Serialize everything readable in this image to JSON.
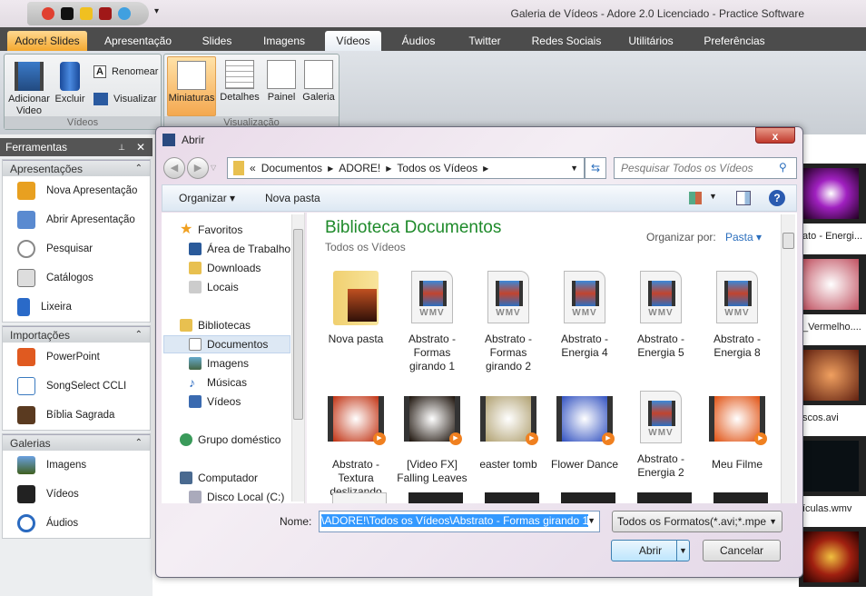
{
  "window": {
    "title": "Galeria de Vídeos - Adore 2.0 Licenciado - Practice Software"
  },
  "qat": {
    "icons": [
      "help-icon",
      "screen-icon",
      "notes-icon",
      "bible-icon",
      "chat-icon"
    ],
    "more": "▾"
  },
  "tabs": [
    {
      "label": "Adore! Slides"
    },
    {
      "label": "Apresentação"
    },
    {
      "label": "Slides"
    },
    {
      "label": "Imagens"
    },
    {
      "label": "Vídeos",
      "selected": true
    },
    {
      "label": "Áudios"
    },
    {
      "label": "Twitter"
    },
    {
      "label": "Redes Sociais"
    },
    {
      "label": "Utilitários"
    },
    {
      "label": "Preferências"
    }
  ],
  "ribbon": {
    "videos_group": {
      "label": "Vídeos",
      "add": "Adicionar Video",
      "delete": "Excluir",
      "rename": "Renomear",
      "preview": "Visualizar"
    },
    "view_group": {
      "label": "Visualização",
      "items": [
        {
          "label": "Miniaturas",
          "selected": true
        },
        {
          "label": "Detalhes"
        },
        {
          "label": "Painel"
        },
        {
          "label": "Galeria"
        }
      ]
    }
  },
  "left_panel": {
    "title": "Ferramentas",
    "pin": "📌",
    "close": "✕",
    "sections": [
      {
        "title": "Apresentações",
        "items": [
          "Nova Apresentação",
          "Abrir Apresentação",
          "Pesquisar",
          "Catálogos",
          "Lixeira"
        ]
      },
      {
        "title": "Importações",
        "items": [
          "PowerPoint",
          "SongSelect CCLI",
          "Bíblia Sagrada"
        ]
      },
      {
        "title": "Galerias",
        "items": [
          "Imagens",
          "Vídeos",
          "Áudios"
        ]
      }
    ],
    "collapse": "⌃"
  },
  "gallery": {
    "labels": [
      "ato - Energi...",
      "_Vermelho....",
      "scos.avi",
      "ículas.wmv"
    ]
  },
  "dialog": {
    "title": "Abrir",
    "close": "x",
    "address": {
      "prefix": "«",
      "parts": [
        "Documentos",
        "ADORE!",
        "Todos os Vídeos"
      ]
    },
    "search_placeholder": "Pesquisar Todos os Vídeos",
    "toolbar": {
      "organize": "Organizar ▾",
      "new_folder": "Nova pasta"
    },
    "nav": {
      "favorites": "Favoritos",
      "fav_items": [
        "Área de Trabalho",
        "Downloads",
        "Locais"
      ],
      "libraries": "Bibliotecas",
      "lib_items": [
        "Documentos",
        "Imagens",
        "Músicas",
        "Vídeos"
      ],
      "homegroup": "Grupo doméstico",
      "computer": "Computador",
      "computer_items": [
        "Disco Local (C:)"
      ],
      "selected": "Documentos"
    },
    "library_title": "Biblioteca Documentos",
    "library_sub": "Todos os Vídeos",
    "arrange_label": "Organizar por:",
    "arrange_value": "Pasta ▾",
    "files": [
      {
        "name": "Nova pasta",
        "type": "folder"
      },
      {
        "name": "Abstrato - Formas girando 1",
        "type": "wmv"
      },
      {
        "name": "Abstrato - Formas girando 2",
        "type": "wmv"
      },
      {
        "name": "Abstrato - Energia 4",
        "type": "wmv"
      },
      {
        "name": "Abstrato - Energia 5",
        "type": "wmv"
      },
      {
        "name": "Abstrato - Energia 8",
        "type": "wmv"
      },
      {
        "name": "Abstrato - Textura deslizando",
        "type": "video",
        "color": "#c03010"
      },
      {
        "name": "[Video FX] Falling Leaves",
        "type": "video",
        "color": "#1a1008"
      },
      {
        "name": "easter tomb",
        "type": "video",
        "color": "#b0a070"
      },
      {
        "name": "Flower Dance",
        "type": "video",
        "color": "#3050c0"
      },
      {
        "name": "Abstrato - Energia 2",
        "type": "wmv"
      },
      {
        "name": "Meu Filme",
        "type": "video",
        "color": "#e05010"
      }
    ],
    "wmv_label": "WMV",
    "filename_label": "Nome:",
    "filename_value": "\\ADORE!\\Todos os Vídeos\\Abstrato - Formas girando 1",
    "filetype_value": "Todos os Formatos(*.avi;*.mpe",
    "open": "Abrir",
    "cancel": "Cancelar"
  }
}
